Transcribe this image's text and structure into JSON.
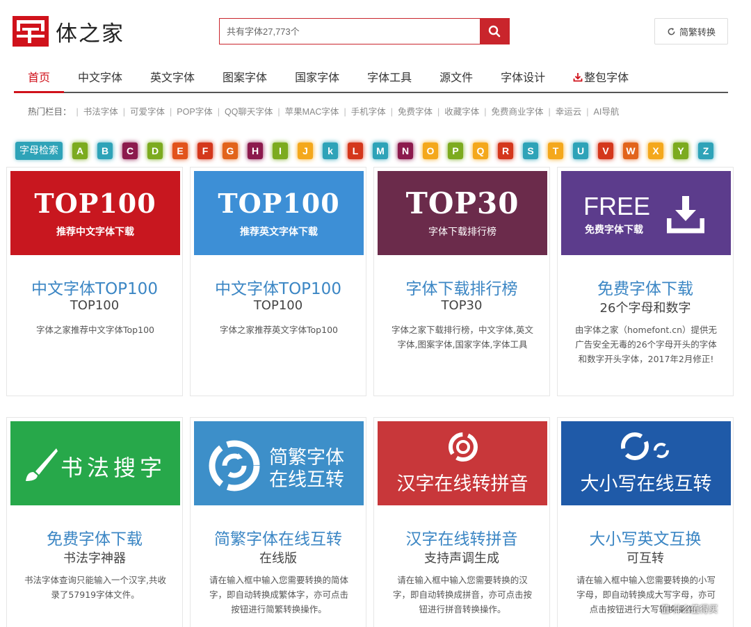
{
  "colors": {
    "brand_red": "#d0121b",
    "link_blue": "#3b86c4",
    "search_red": "#c9252c"
  },
  "logo": {
    "text": "体之家",
    "icon": "logo-icon"
  },
  "search": {
    "placeholder": "共有字体27,773个",
    "icon": "search-icon"
  },
  "convert": {
    "label": "简繁转换",
    "icon": "refresh-icon"
  },
  "nav": {
    "items": [
      {
        "label": "首页",
        "active": true
      },
      {
        "label": "中文字体"
      },
      {
        "label": "英文字体"
      },
      {
        "label": "图案字体"
      },
      {
        "label": "国家字体"
      },
      {
        "label": "字体工具"
      },
      {
        "label": "源文件"
      },
      {
        "label": "字体设计"
      },
      {
        "label": "整包字体",
        "icon": "download-icon"
      }
    ]
  },
  "hot": {
    "label": "热门栏目：",
    "items": [
      "书法字体",
      "可爱字体",
      "POP字体",
      "QQ聊天字体",
      "苹果MAC字体",
      "手机字体",
      "免费字体",
      "收藏字体",
      "免费商业字体",
      "幸运云",
      "AI导航"
    ]
  },
  "letters": {
    "label": "字母检索",
    "items": [
      {
        "l": "A",
        "c": "#7cab1f"
      },
      {
        "l": "B",
        "c": "#2ea3b8"
      },
      {
        "l": "C",
        "c": "#8c1a4d"
      },
      {
        "l": "D",
        "c": "#7cab1f"
      },
      {
        "l": "E",
        "c": "#e2531b"
      },
      {
        "l": "F",
        "c": "#d4371c"
      },
      {
        "l": "G",
        "c": "#e2641b"
      },
      {
        "l": "H",
        "c": "#8c1a4d"
      },
      {
        "l": "I",
        "c": "#7cab1f"
      },
      {
        "l": "J",
        "c": "#f4a81c"
      },
      {
        "l": "k",
        "c": "#2ea3b8"
      },
      {
        "l": "L",
        "c": "#d4371c"
      },
      {
        "l": "M",
        "c": "#2ea3b8"
      },
      {
        "l": "N",
        "c": "#8c1a4d"
      },
      {
        "l": "O",
        "c": "#f4a81c"
      },
      {
        "l": "P",
        "c": "#7cab1f"
      },
      {
        "l": "Q",
        "c": "#f4a81c"
      },
      {
        "l": "R",
        "c": "#d4371c"
      },
      {
        "l": "S",
        "c": "#2ea3b8"
      },
      {
        "l": "T",
        "c": "#f4a81c"
      },
      {
        "l": "U",
        "c": "#2ea3b8"
      },
      {
        "l": "V",
        "c": "#d4371c"
      },
      {
        "l": "W",
        "c": "#e2641b"
      },
      {
        "l": "X",
        "c": "#f4a81c"
      },
      {
        "l": "Y",
        "c": "#7cab1f"
      },
      {
        "l": "Z",
        "c": "#2ea3b8"
      }
    ]
  },
  "cards": [
    {
      "banner_big": "TOP100",
      "banner_small": "推荐中文字体下载",
      "banner_color": "#c8171f",
      "title": "中文字体TOP100",
      "sub": "TOP100",
      "desc": "字体之家推荐中文字体Top100"
    },
    {
      "banner_big": "TOP100",
      "banner_small": "推荐英文字体下载",
      "banner_color": "#3d8fd6",
      "title": "中文字体TOP100",
      "sub": "TOP100",
      "desc": "字体之家推荐英文字体Top100"
    },
    {
      "banner_big": "TOP30",
      "banner_small": "字体下载排行榜",
      "banner_color": "#6b2b4b",
      "title": "字体下载排行榜",
      "sub": "TOP30",
      "desc": "字体之家下载排行榜，中文字体,英文字体,图案字体,国家字体,字体工具"
    },
    {
      "banner_big": "FREE",
      "banner_small": "免费字体下载",
      "banner_color": "#5c3c8c",
      "banner_icon": "download-icon",
      "title": "免费字体下载",
      "sub": "26个字母和数字",
      "desc": "由字体之家（homefont.cn）提供无广告安全无毒的26个字母开头的字体和数字开头字体，2017年2月修正!"
    },
    {
      "banner_text": "书法搜字",
      "banner_color": "#27a84a",
      "banner_icon": "brush-icon",
      "title": "免费字体下载",
      "sub": "书法字神器",
      "desc": "书法字体查询只能输入一个汉字,共收录了57919字体文件。"
    },
    {
      "banner_line1": "简繁字体",
      "banner_line2": "在线互转",
      "banner_color": "#3d8fc9",
      "banner_icon": "refresh-circle-icon",
      "title": "简繁字体在线互转",
      "sub": "在线版",
      "desc": "请在输入框中输入您需要转换的简体字，即自动转换成繁体字，亦可点击按钮进行简繁转换操作。"
    },
    {
      "banner_text": "汉字在线转拼音",
      "banner_color": "#c8373a",
      "banner_icon": "target-icon",
      "title": "汉字在线转拼音",
      "sub": "支持声调生成",
      "desc": "请在输入框中输入您需要转换的汉字，即自动转换成拼音，亦可点击按钮进行拼音转换操作。"
    },
    {
      "banner_text": "大小写在线互转",
      "banner_color": "#1f5aa8",
      "banner_icon": "circle-arrows-icon",
      "title": "大小写英文互换",
      "sub": "可互转",
      "desc": "请在输入框中输入您需要转换的小写字母，即自动转换成大写字母，亦可点击按钮进行大写转换操作。"
    }
  ],
  "watermark": "值 什么值得买"
}
